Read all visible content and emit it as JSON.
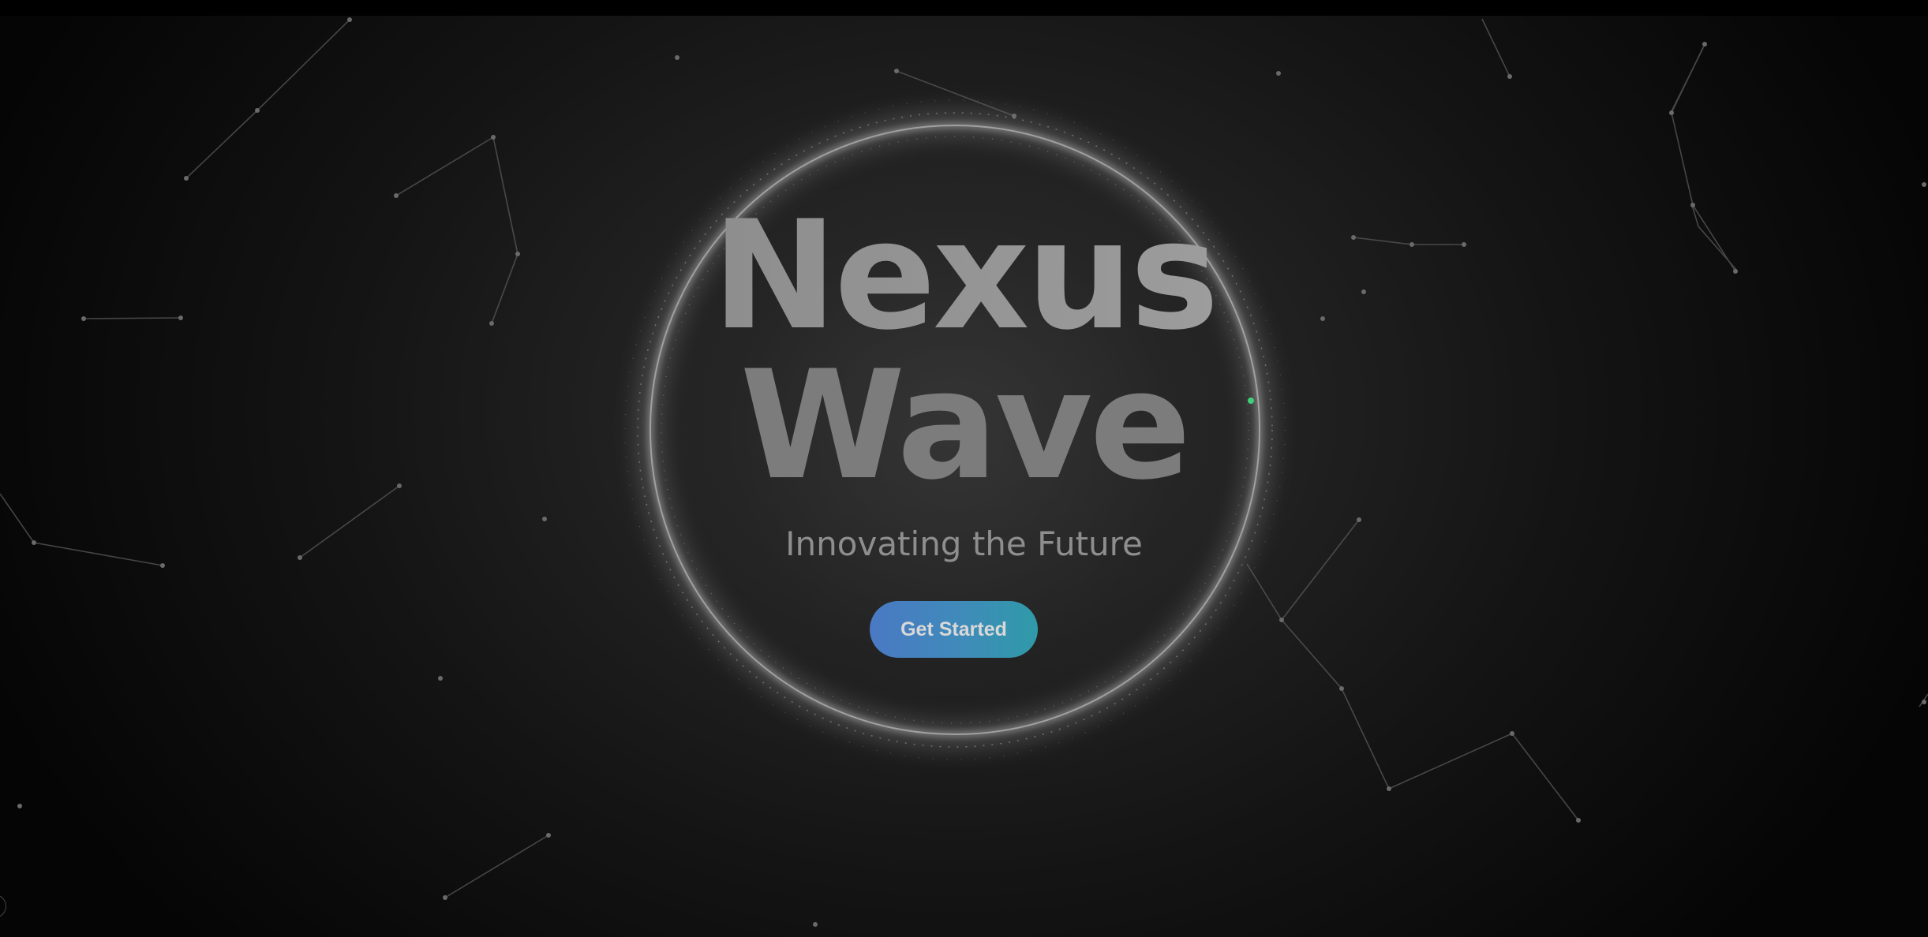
{
  "hero": {
    "title_line_1": "Nexus",
    "title_line_2": "Wave",
    "subtitle": "Innovating the Future",
    "cta_label": "Get Started"
  },
  "colors": {
    "background": "#1c1c1c",
    "accent_start": "#4a79c4",
    "accent_end": "#2f9aa8",
    "particle_highlight": "#3fd07a"
  },
  "icons": {
    "corner_control": "circle-outline-icon"
  }
}
